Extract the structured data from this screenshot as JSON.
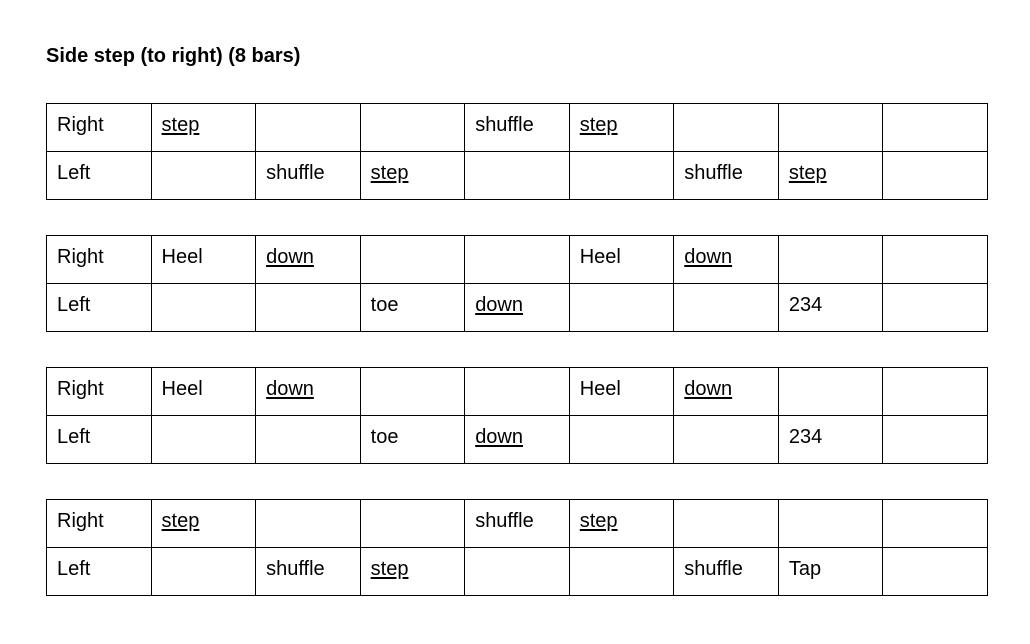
{
  "document": {
    "title": "Side step (to right) (8 bars)"
  },
  "tables": [
    {
      "rows": [
        {
          "label": "Right",
          "cells": [
            {
              "text": "step",
              "underline": true
            },
            {
              "text": ""
            },
            {
              "text": ""
            },
            {
              "text": "shuffle"
            },
            {
              "text": "step",
              "underline": true
            },
            {
              "text": ""
            },
            {
              "text": ""
            },
            {
              "text": ""
            }
          ]
        },
        {
          "label": "Left",
          "cells": [
            {
              "text": ""
            },
            {
              "text": "shuffle"
            },
            {
              "text": "step",
              "underline": true
            },
            {
              "text": ""
            },
            {
              "text": ""
            },
            {
              "text": "shuffle"
            },
            {
              "text": "step",
              "underline": true
            },
            {
              "text": ""
            }
          ]
        }
      ]
    },
    {
      "rows": [
        {
          "label": "Right",
          "cells": [
            {
              "text": "Heel"
            },
            {
              "text": "down",
              "underline": true
            },
            {
              "text": ""
            },
            {
              "text": ""
            },
            {
              "text": "Heel"
            },
            {
              "text": "down",
              "underline": true
            },
            {
              "text": ""
            },
            {
              "text": ""
            }
          ]
        },
        {
          "label": "Left",
          "cells": [
            {
              "text": ""
            },
            {
              "text": ""
            },
            {
              "text": "toe"
            },
            {
              "text": "down",
              "underline": true
            },
            {
              "text": ""
            },
            {
              "text": ""
            },
            {
              "text": "234"
            },
            {
              "text": ""
            }
          ]
        }
      ]
    },
    {
      "rows": [
        {
          "label": "Right",
          "cells": [
            {
              "text": "Heel"
            },
            {
              "text": "down",
              "underline": true
            },
            {
              "text": ""
            },
            {
              "text": ""
            },
            {
              "text": "Heel"
            },
            {
              "text": "down",
              "underline": true
            },
            {
              "text": ""
            },
            {
              "text": ""
            }
          ]
        },
        {
          "label": "Left",
          "cells": [
            {
              "text": ""
            },
            {
              "text": ""
            },
            {
              "text": "toe"
            },
            {
              "text": "down",
              "underline": true
            },
            {
              "text": ""
            },
            {
              "text": ""
            },
            {
              "text": "234"
            },
            {
              "text": ""
            }
          ]
        }
      ]
    },
    {
      "rows": [
        {
          "label": "Right",
          "cells": [
            {
              "text": "step",
              "underline": true
            },
            {
              "text": ""
            },
            {
              "text": ""
            },
            {
              "text": "shuffle"
            },
            {
              "text": "step",
              "underline": true
            },
            {
              "text": ""
            },
            {
              "text": ""
            },
            {
              "text": ""
            }
          ]
        },
        {
          "label": "Left",
          "cells": [
            {
              "text": ""
            },
            {
              "text": "shuffle"
            },
            {
              "text": "step",
              "underline": true
            },
            {
              "text": ""
            },
            {
              "text": ""
            },
            {
              "text": "shuffle"
            },
            {
              "text": "Tap"
            },
            {
              "text": ""
            }
          ]
        }
      ]
    }
  ]
}
